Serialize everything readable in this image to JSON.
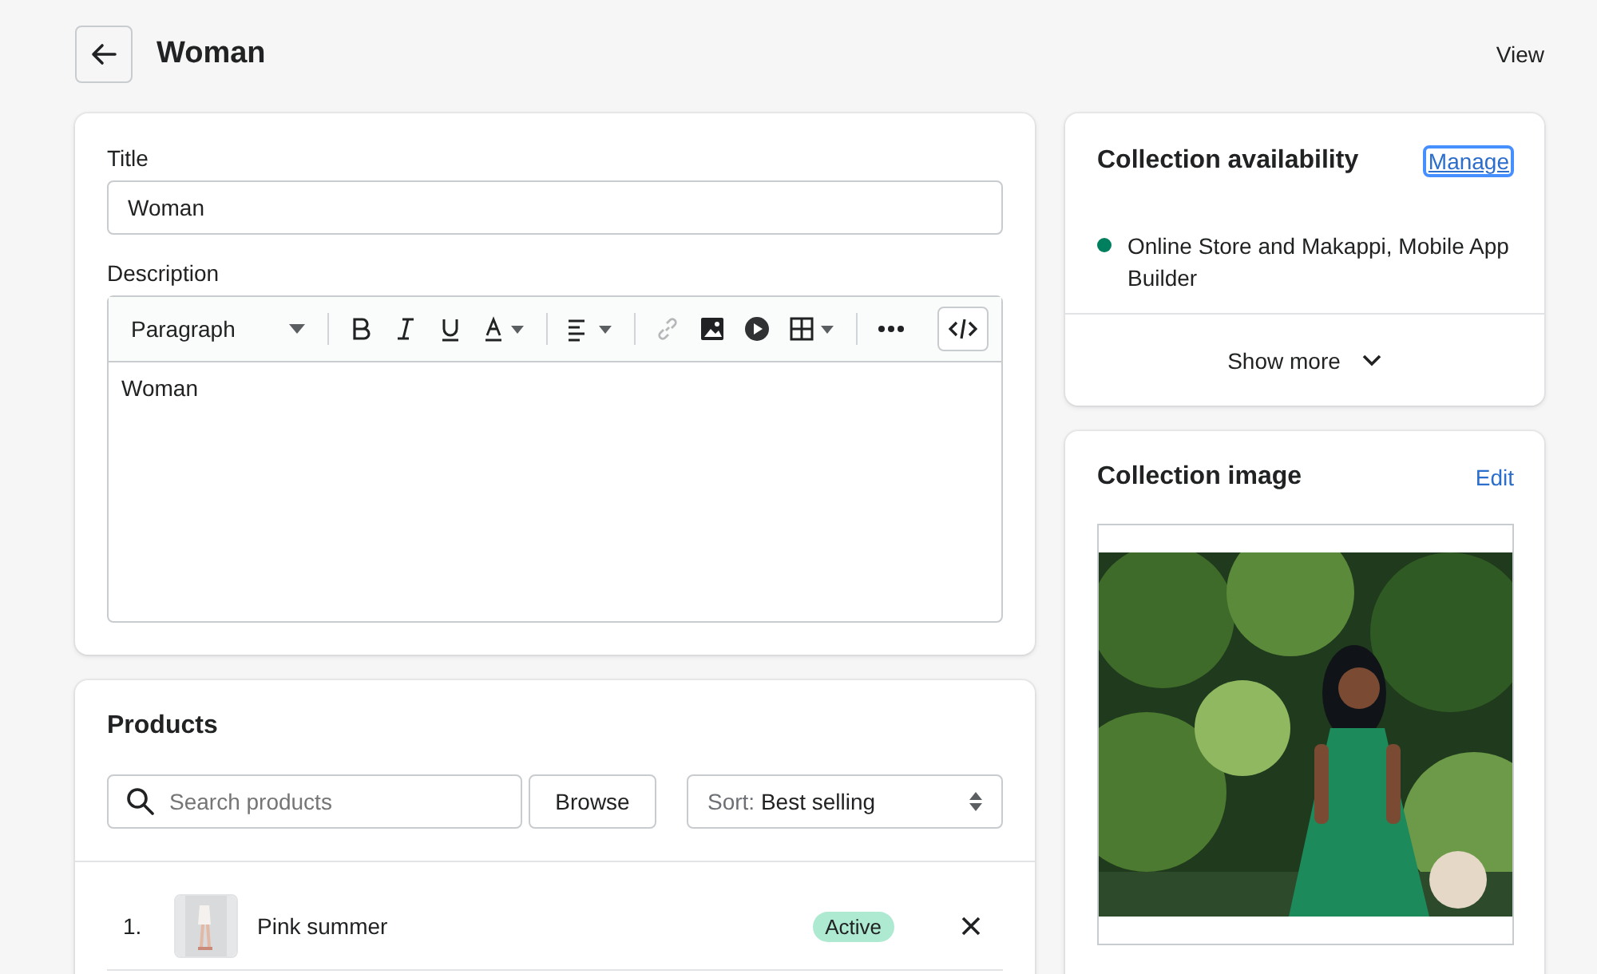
{
  "header": {
    "title": "Woman",
    "view_label": "View"
  },
  "details": {
    "title_label": "Title",
    "title_value": "Woman",
    "description_label": "Description",
    "block_format": "Paragraph",
    "description_text": "Woman"
  },
  "products": {
    "heading": "Products",
    "search_placeholder": "Search products",
    "browse_label": "Browse",
    "sort_prefix": "Sort:",
    "sort_value": "Best selling",
    "rows": [
      {
        "number": "1.",
        "name": "Pink summer",
        "status": "Active"
      }
    ]
  },
  "availability": {
    "heading": "Collection availability",
    "manage_label": "Manage",
    "channels": [
      {
        "name": "Online Store and Makappi, Mobile App Builder",
        "color": "#007f5f"
      }
    ],
    "show_more": "Show more"
  },
  "collection_image": {
    "heading": "Collection image",
    "edit_label": "Edit"
  }
}
